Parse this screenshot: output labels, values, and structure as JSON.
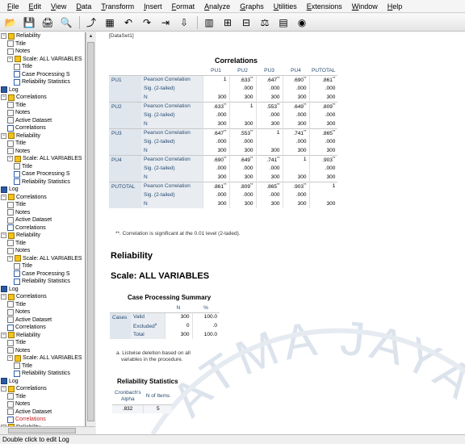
{
  "menu": [
    "File",
    "Edit",
    "View",
    "Data",
    "Transform",
    "Insert",
    "Format",
    "Analyze",
    "Graphs",
    "Utilities",
    "Extensions",
    "Window",
    "Help"
  ],
  "toolbar_icons": [
    "open-icon",
    "save-icon",
    "print-icon",
    "print-preview-icon",
    "export-icon",
    "goto-data-icon",
    "undo-icon",
    "redo-icon",
    "goto-case-icon",
    "goto-variable-icon",
    "variables-icon",
    "insert-case-icon",
    "split-file-icon",
    "select-cases-icon",
    "value-labels-icon",
    "show-all-variables-icon"
  ],
  "outline": [
    {
      "label": "Reliability",
      "depth": 0,
      "icon": "procedure-icon",
      "exp": true
    },
    {
      "label": "Title",
      "depth": 1,
      "icon": "title-icon"
    },
    {
      "label": "Notes",
      "depth": 1,
      "icon": "notes-icon"
    },
    {
      "label": "Scale: ALL VARIABLES",
      "depth": 1,
      "icon": "procedure-icon",
      "exp": true
    },
    {
      "label": "Title",
      "depth": 2,
      "icon": "title-icon"
    },
    {
      "label": "Case Processing S",
      "depth": 2,
      "icon": "table-icon"
    },
    {
      "label": "Reliability Statistics",
      "depth": 2,
      "icon": "table-icon"
    },
    {
      "label": "Log",
      "depth": 0,
      "icon": "log-icon"
    },
    {
      "label": "Correlations",
      "depth": 0,
      "icon": "procedure-icon",
      "exp": true
    },
    {
      "label": "Title",
      "depth": 1,
      "icon": "title-icon"
    },
    {
      "label": "Notes",
      "depth": 1,
      "icon": "notes-icon"
    },
    {
      "label": "Active Dataset",
      "depth": 1,
      "icon": "notes-icon"
    },
    {
      "label": "Correlations",
      "depth": 1,
      "icon": "table-icon"
    },
    {
      "label": "Reliability",
      "depth": 0,
      "icon": "procedure-icon",
      "exp": true
    },
    {
      "label": "Title",
      "depth": 1,
      "icon": "title-icon"
    },
    {
      "label": "Notes",
      "depth": 1,
      "icon": "notes-icon"
    },
    {
      "label": "Scale: ALL VARIABLES",
      "depth": 1,
      "icon": "procedure-icon",
      "exp": true
    },
    {
      "label": "Title",
      "depth": 2,
      "icon": "title-icon"
    },
    {
      "label": "Case Processing S",
      "depth": 2,
      "icon": "table-icon"
    },
    {
      "label": "Reliability Statistics",
      "depth": 2,
      "icon": "table-icon"
    },
    {
      "label": "Log",
      "depth": 0,
      "icon": "log-icon"
    },
    {
      "label": "Correlations",
      "depth": 0,
      "icon": "procedure-icon",
      "exp": true
    },
    {
      "label": "Title",
      "depth": 1,
      "icon": "title-icon"
    },
    {
      "label": "Notes",
      "depth": 1,
      "icon": "notes-icon"
    },
    {
      "label": "Active Dataset",
      "depth": 1,
      "icon": "notes-icon"
    },
    {
      "label": "Correlations",
      "depth": 1,
      "icon": "table-icon"
    },
    {
      "label": "Reliability",
      "depth": 0,
      "icon": "procedure-icon",
      "exp": true
    },
    {
      "label": "Title",
      "depth": 1,
      "icon": "title-icon"
    },
    {
      "label": "Notes",
      "depth": 1,
      "icon": "notes-icon"
    },
    {
      "label": "Scale: ALL VARIABLES",
      "depth": 1,
      "icon": "procedure-icon",
      "exp": true
    },
    {
      "label": "Title",
      "depth": 2,
      "icon": "title-icon"
    },
    {
      "label": "Case Processing S",
      "depth": 2,
      "icon": "table-icon"
    },
    {
      "label": "Reliability Statistics",
      "depth": 2,
      "icon": "table-icon"
    },
    {
      "label": "Log",
      "depth": 0,
      "icon": "log-icon"
    },
    {
      "label": "Correlations",
      "depth": 0,
      "icon": "procedure-icon",
      "exp": true
    },
    {
      "label": "Title",
      "depth": 1,
      "icon": "title-icon"
    },
    {
      "label": "Notes",
      "depth": 1,
      "icon": "notes-icon"
    },
    {
      "label": "Active Dataset",
      "depth": 1,
      "icon": "notes-icon"
    },
    {
      "label": "Correlations",
      "depth": 1,
      "icon": "table-icon"
    },
    {
      "label": "Reliability",
      "depth": 0,
      "icon": "procedure-icon",
      "exp": true
    },
    {
      "label": "Title",
      "depth": 1,
      "icon": "title-icon"
    },
    {
      "label": "Notes",
      "depth": 1,
      "icon": "notes-icon"
    },
    {
      "label": "Scale: ALL VARIABLES",
      "depth": 1,
      "icon": "procedure-icon",
      "exp": true
    },
    {
      "label": "Title",
      "depth": 2,
      "icon": "title-icon"
    },
    {
      "label": "Reliability Statistics",
      "depth": 2,
      "icon": "table-icon"
    },
    {
      "label": "Log",
      "depth": 0,
      "icon": "log-icon"
    },
    {
      "label": "Correlations",
      "depth": 0,
      "icon": "procedure-icon",
      "exp": true
    },
    {
      "label": "Title",
      "depth": 1,
      "icon": "title-icon"
    },
    {
      "label": "Notes",
      "depth": 1,
      "icon": "notes-icon"
    },
    {
      "label": "Active Dataset",
      "depth": 1,
      "icon": "notes-icon"
    },
    {
      "label": "Correlations",
      "depth": 1,
      "icon": "table-icon",
      "selected": true
    },
    {
      "label": "Reliability",
      "depth": 0,
      "icon": "procedure-icon",
      "exp": true
    }
  ],
  "viewer": {
    "dataset_line": "[DataSet1]",
    "correlations": {
      "title": "Correlations",
      "col_headers": [
        "PU1",
        "PU2",
        "PU3",
        "PU4",
        "PUTOTAL"
      ],
      "rows": [
        {
          "var": "PU1",
          "stats": [
            {
              "label": "Pearson Correlation",
              "values": [
                "1",
                ".633**",
                ".647**",
                ".690**",
                ".861**"
              ]
            },
            {
              "label": "Sig. (2-tailed)",
              "values": [
                "",
                ".000",
                ".000",
                ".000",
                ".000"
              ]
            },
            {
              "label": "N",
              "values": [
                "300",
                "300",
                "300",
                "300",
                "300"
              ]
            }
          ]
        },
        {
          "var": "PU2",
          "stats": [
            {
              "label": "Pearson Correlation",
              "values": [
                ".633**",
                "1",
                ".553**",
                ".649**",
                ".809**"
              ]
            },
            {
              "label": "Sig. (2-tailed)",
              "values": [
                ".000",
                "",
                ".000",
                ".000",
                ".000"
              ]
            },
            {
              "label": "N",
              "values": [
                "300",
                "300",
                "300",
                "300",
                "300"
              ]
            }
          ]
        },
        {
          "var": "PU3",
          "stats": [
            {
              "label": "Pearson Correlation",
              "values": [
                ".647**",
                ".553**",
                "1",
                ".741**",
                ".865**"
              ]
            },
            {
              "label": "Sig. (2-tailed)",
              "values": [
                ".000",
                ".000",
                "",
                ".000",
                ".000"
              ]
            },
            {
              "label": "N",
              "values": [
                "300",
                "300",
                "300",
                "300",
                "300"
              ]
            }
          ]
        },
        {
          "var": "PU4",
          "stats": [
            {
              "label": "Pearson Correlation",
              "values": [
                ".690**",
                ".649**",
                ".741**",
                "1",
                ".903**"
              ]
            },
            {
              "label": "Sig. (2-tailed)",
              "values": [
                ".000",
                ".000",
                ".000",
                "",
                ".000"
              ]
            },
            {
              "label": "N",
              "values": [
                "300",
                "300",
                "300",
                "300",
                "300"
              ]
            }
          ]
        },
        {
          "var": "PUTOTAL",
          "stats": [
            {
              "label": "Pearson Correlation",
              "values": [
                ".861**",
                ".809**",
                ".865**",
                ".903**",
                "1"
              ]
            },
            {
              "label": "Sig. (2-tailed)",
              "values": [
                ".000",
                ".000",
                ".000",
                ".000",
                ""
              ]
            },
            {
              "label": "N",
              "values": [
                "300",
                "300",
                "300",
                "300",
                "300"
              ]
            }
          ]
        }
      ],
      "footnote": "**. Correlation is significant at the 0.01 level (2-tailed)."
    },
    "reliability_title": "Reliability",
    "scale_title": "Scale: ALL VARIABLES",
    "case_processing": {
      "title": "Case Processing Summary",
      "col_headers": [
        "N",
        "%"
      ],
      "group": "Cases",
      "rows": [
        {
          "label": "Valid",
          "n": "300",
          "pct": "100.0"
        },
        {
          "label": "Excluded",
          "sup": "a",
          "n": "0",
          "pct": ".0"
        },
        {
          "label": "Total",
          "n": "300",
          "pct": "100.0"
        }
      ],
      "footnote_1": "a. Listwise deletion based on all",
      "footnote_2": "variables in the procedure."
    },
    "reliability_stats": {
      "title": "Reliability Statistics",
      "col1_line1": "Cronbach's",
      "col1_line2": "Alpha",
      "col2": "N of Items",
      "alpha": ".832",
      "n_items": "5"
    },
    "watermark": "ATMA JAYA"
  },
  "status_text": "Double click to edit Log"
}
